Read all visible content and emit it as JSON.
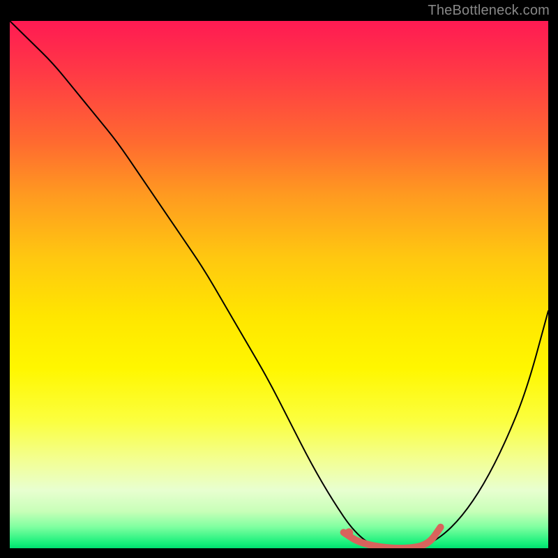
{
  "watermark": "TheBottleneck.com",
  "chart_data": {
    "type": "line",
    "title": "",
    "xlabel": "",
    "ylabel": "",
    "xlim": [
      0,
      100
    ],
    "ylim": [
      0,
      100
    ],
    "series": [
      {
        "name": "bottleneck-curve",
        "x": [
          0,
          4,
          8,
          12,
          16,
          20,
          24,
          28,
          32,
          36,
          40,
          44,
          48,
          52,
          56,
          60,
          64,
          68,
          72,
          76,
          80,
          84,
          88,
          92,
          96,
          100
        ],
        "y": [
          100,
          96,
          92,
          87,
          82,
          77,
          71,
          65,
          59,
          53,
          46,
          39,
          32,
          24,
          16,
          9,
          3,
          0,
          0,
          0,
          2,
          6,
          12,
          20,
          30,
          45
        ]
      },
      {
        "name": "highlight-region",
        "x": [
          62,
          65,
          70,
          75,
          78,
          80
        ],
        "y": [
          3,
          1,
          0,
          0,
          1,
          4
        ]
      }
    ],
    "colors": {
      "curve": "#000000",
      "highlight": "#d9635c",
      "accent_dot": "#d9635c"
    },
    "accent_dot": {
      "x": 63,
      "y": 3
    }
  }
}
